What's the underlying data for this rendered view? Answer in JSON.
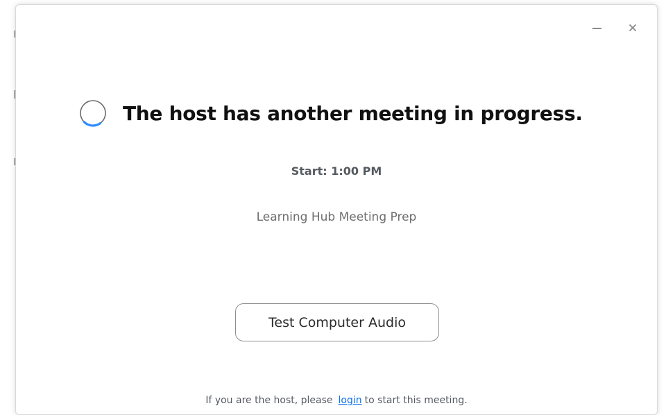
{
  "window": {
    "minimize_icon": "minimize-icon",
    "close_icon": "close-icon",
    "close_glyph": "×"
  },
  "status": {
    "spinner_icon": "loading-spinner-icon",
    "heading": "The host has another meeting in progress.",
    "start_time": "Start: 1:00 PM",
    "meeting_name": "Learning Hub Meeting Prep"
  },
  "actions": {
    "test_audio_label": "Test Computer Audio"
  },
  "footer": {
    "prefix": "If you are the host, please",
    "link_label": "login",
    "suffix": "to start this meeting."
  },
  "colors": {
    "link": "#0e71eb",
    "spinner_arc": "#2d8cff",
    "spinner_track": "#6b6b6b"
  }
}
